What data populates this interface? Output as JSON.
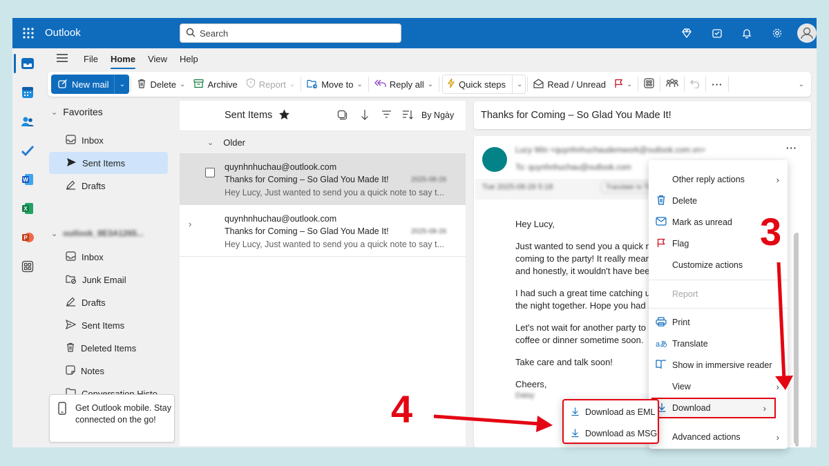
{
  "app": {
    "name": "Outlook"
  },
  "search": {
    "placeholder": "Search"
  },
  "menu": {
    "tabs": [
      "File",
      "Home",
      "View",
      "Help"
    ]
  },
  "ribbon": {
    "new_mail": "New mail",
    "delete": "Delete",
    "archive": "Archive",
    "report": "Report",
    "move_to": "Move to",
    "reply_all": "Reply all",
    "quick_steps": "Quick steps",
    "read_unread": "Read / Unread"
  },
  "nav": {
    "favorites": {
      "header": "Favorites",
      "items": [
        {
          "label": "Inbox",
          "icon": "inbox-icon"
        },
        {
          "label": "Sent Items",
          "icon": "send-icon"
        },
        {
          "label": "Drafts",
          "icon": "pencil-icon"
        }
      ]
    },
    "account": {
      "header": "outlook_8E3A1265...",
      "items": [
        {
          "label": "Inbox",
          "icon": "inbox-icon"
        },
        {
          "label": "Junk Email",
          "icon": "junk-icon"
        },
        {
          "label": "Drafts",
          "icon": "pencil-icon"
        },
        {
          "label": "Sent Items",
          "icon": "send-icon"
        },
        {
          "label": "Deleted Items",
          "icon": "trash-icon"
        },
        {
          "label": "Notes",
          "icon": "note-icon"
        },
        {
          "label": "Conversation Histo...",
          "icon": "folder-icon"
        }
      ]
    },
    "mobile_promo": "Get Outlook mobile. Stay connected on the go!"
  },
  "list": {
    "title": "Sent Items",
    "sort": "By Ngày",
    "group": "Older",
    "messages": [
      {
        "from": "quynhnhuchau@outlook.com",
        "subject": "Thanks for Coming – So Glad You Made It!",
        "preview": "Hey Lucy, Just wanted to send you a quick note to say t...",
        "date": "2025-08-26"
      },
      {
        "from": "quynhnhuchau@outlook.com",
        "subject": "Thanks for Coming – So Glad You Made It!",
        "preview": "Hey Lucy, Just wanted to send you a quick note to say t...",
        "date": "2025-08-26"
      }
    ]
  },
  "reading": {
    "subject": "Thanks for Coming – So Glad You Made It!",
    "from": "Lucy Win <quynhnhuchaudemwork@outlook.com.vn>",
    "to": "To: quynhnhuchau@outlook.com",
    "date": "Tue 2025-08-26 5:18",
    "translate": "Translate to Tiếng Việt",
    "greeting": "Hey Lucy,",
    "p1_l1": "Just wanted to send you a quick n",
    "p1_l2": "coming to the party! It really mear",
    "p1_l3": "and honestly, it wouldn't have bee",
    "p2_l1": "I had such a great time catching u",
    "p2_l2": "the night together. Hope you had a",
    "p3_l1": "Let's not wait for another party to",
    "p3_l2": "coffee or dinner sometime soon.",
    "p4": "Take care and talk soon!",
    "signoff": "Cheers,",
    "signature": "Daisy"
  },
  "context_menu": {
    "items": [
      "Other reply actions",
      "Delete",
      "Mark as unread",
      "Flag",
      "Customize actions",
      "Report",
      "Print",
      "Translate",
      "Show in immersive reader",
      "View",
      "Download",
      "Advanced actions"
    ]
  },
  "submenu": {
    "items": [
      "Download as EML",
      "Download as MSG"
    ]
  },
  "annotations": {
    "step3": "3",
    "step4": "4"
  },
  "colors": {
    "brand": "#0f6cbd",
    "annotation_red": "#e30613",
    "selected": "#cfe4fa"
  }
}
